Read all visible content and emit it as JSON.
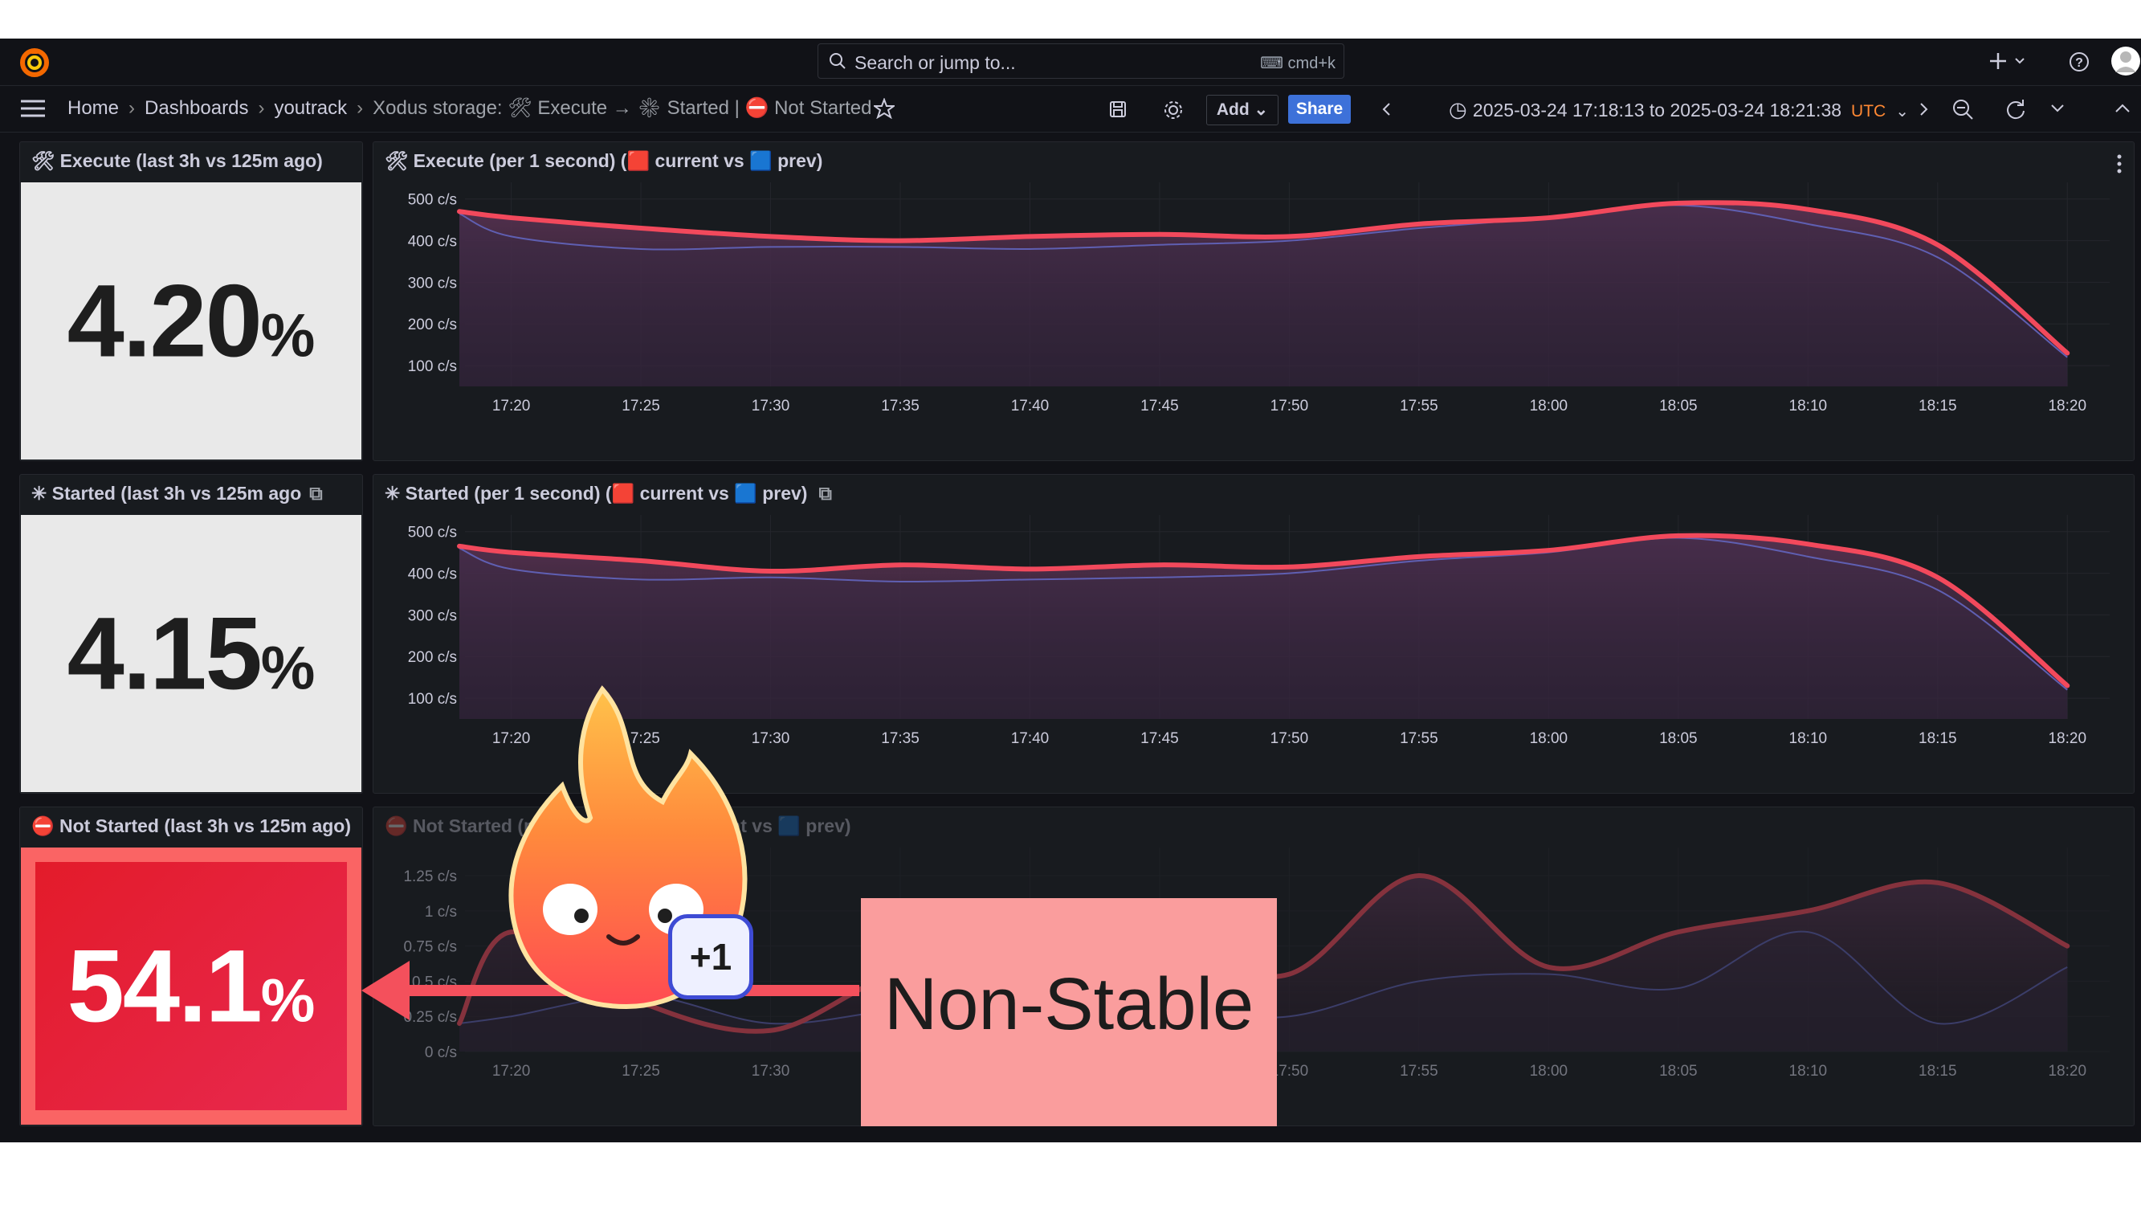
{
  "topbar": {
    "search_placeholder": "Search or jump to...",
    "search_shortcut": "cmd+k",
    "icons": [
      "grafana-logo-icon",
      "plus-icon",
      "help-icon",
      "user-avatar"
    ]
  },
  "navbar": {
    "breadcrumbs": [
      "Home",
      "Dashboards",
      "youtrack",
      "Xodus storage: 🛠 Execute → ✳ Started | ⛔ Not Started"
    ],
    "add_label": "Add",
    "share_label": "Share",
    "time_range": "2025-03-24 17:18:13 to 2025-03-24 18:21:38",
    "timezone": "UTC"
  },
  "panels": {
    "stat_execute": {
      "title": "🛠 Execute (last 3h vs 125m ago)",
      "value": "4.20",
      "unit": "%"
    },
    "stat_started": {
      "title": "✳ Started (last 3h vs 125m ago",
      "value": "4.15",
      "unit": "%"
    },
    "stat_not_started": {
      "title": "⛔ Not Started (last 3h vs 125m ago)",
      "value": "54.1",
      "unit": "%"
    },
    "ts_execute_title": "🛠 Execute (per 1 second) (🟥 current vs 🟦 prev)",
    "ts_started_title": "✳ Started (per 1 second) (🟥 current vs 🟦 prev)",
    "ts_not_started_title": "⛔ Not Started (per 1 second) (🟥 current vs 🟦 prev)"
  },
  "overlay": {
    "badge": "+1",
    "callout": "Non-Stable"
  },
  "colors": {
    "current": "#f2495c",
    "prev": "#5f5fb2",
    "not_started_stat_bg": "#e8233a",
    "stat_bg": "#e9e9e9"
  },
  "chart_data": [
    {
      "type": "line",
      "x": [
        "17:18",
        "17:20",
        "17:25",
        "17:30",
        "17:35",
        "17:40",
        "17:45",
        "17:50",
        "17:55",
        "18:00",
        "18:05",
        "18:10",
        "18:15",
        "18:20"
      ],
      "x_ticks": [
        "17:20",
        "17:25",
        "17:30",
        "17:35",
        "17:40",
        "17:45",
        "17:50",
        "17:55",
        "18:00",
        "18:05",
        "18:10",
        "18:15",
        "18:20"
      ],
      "y_ticks": [
        "100 c/s",
        "200 c/s",
        "300 c/s",
        "400 c/s",
        "500 c/s"
      ],
      "ylim": [
        50,
        540
      ],
      "series": [
        {
          "name": "current",
          "values": [
            470,
            455,
            430,
            410,
            400,
            410,
            415,
            410,
            440,
            455,
            490,
            475,
            390,
            130
          ]
        },
        {
          "name": "prev",
          "values": [
            465,
            410,
            380,
            385,
            385,
            380,
            390,
            400,
            430,
            455,
            485,
            440,
            360,
            120
          ]
        }
      ]
    },
    {
      "type": "line",
      "x": [
        "17:18",
        "17:20",
        "17:25",
        "17:30",
        "17:35",
        "17:40",
        "17:45",
        "17:50",
        "17:55",
        "18:00",
        "18:05",
        "18:10",
        "18:15",
        "18:20"
      ],
      "x_ticks": [
        "17:20",
        "17:25",
        "17:30",
        "17:35",
        "17:40",
        "17:45",
        "17:50",
        "17:55",
        "18:00",
        "18:05",
        "18:10",
        "18:15",
        "18:20"
      ],
      "y_ticks": [
        "100 c/s",
        "200 c/s",
        "300 c/s",
        "400 c/s",
        "500 c/s"
      ],
      "ylim": [
        50,
        540
      ],
      "series": [
        {
          "name": "current",
          "values": [
            465,
            450,
            430,
            405,
            420,
            410,
            420,
            415,
            440,
            455,
            490,
            470,
            390,
            130
          ]
        },
        {
          "name": "prev",
          "values": [
            460,
            410,
            385,
            390,
            380,
            385,
            390,
            400,
            430,
            450,
            485,
            440,
            360,
            120
          ]
        }
      ]
    },
    {
      "type": "line",
      "x": [
        "17:18",
        "17:20",
        "17:25",
        "17:30",
        "17:35",
        "17:40",
        "17:45",
        "17:50",
        "17:55",
        "18:00",
        "18:05",
        "18:10",
        "18:15",
        "18:20"
      ],
      "x_ticks": [
        "17:20",
        "17:25",
        "17:30",
        "17:35",
        "17:40",
        "17:45",
        "17:50",
        "17:55",
        "18:00",
        "18:05",
        "18:10",
        "18:15",
        "18:20"
      ],
      "y_ticks": [
        "0 c/s",
        "0.25 c/s",
        "0.5 c/s",
        "0.75 c/s",
        "1 c/s",
        "1.25 c/s"
      ],
      "ylim": [
        0,
        1.45
      ],
      "series": [
        {
          "name": "current",
          "values": [
            0.2,
            0.85,
            0.35,
            0.15,
            0.55,
            0.45,
            0.7,
            0.55,
            1.25,
            0.6,
            0.85,
            1.0,
            1.2,
            0.75
          ]
        },
        {
          "name": "prev",
          "values": [
            0.2,
            0.25,
            0.4,
            0.2,
            0.3,
            0.35,
            0.3,
            0.25,
            0.5,
            0.55,
            0.45,
            0.85,
            0.2,
            0.6
          ]
        }
      ]
    }
  ]
}
